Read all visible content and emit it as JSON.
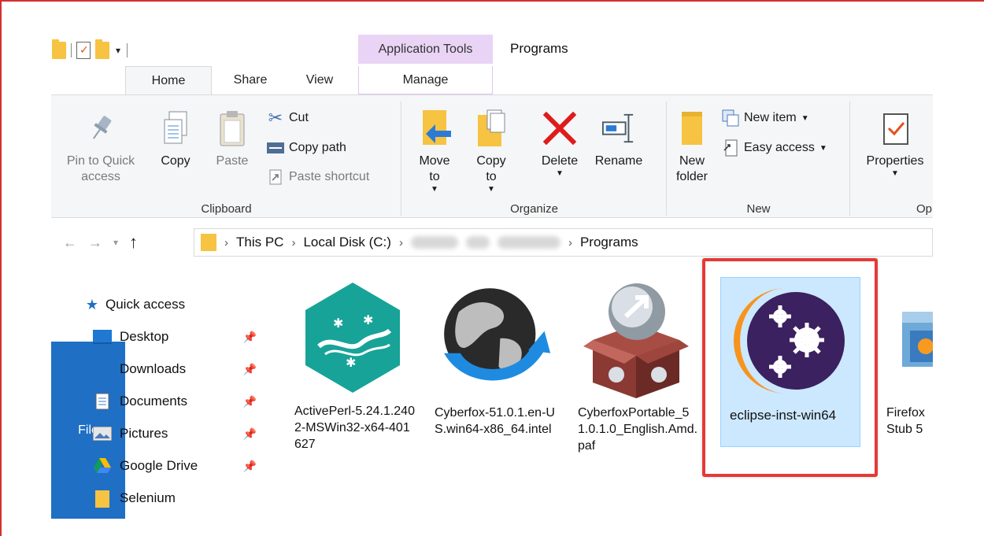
{
  "window": {
    "contextual_tab": "Application Tools",
    "title": "Programs"
  },
  "tabs": [
    "File",
    "Home",
    "Share",
    "View",
    "Manage"
  ],
  "ribbon": {
    "clipboard": {
      "group_label": "Clipboard",
      "pin": "Pin to Quick access",
      "copy": "Copy",
      "paste": "Paste",
      "cut": "Cut",
      "copy_path": "Copy path",
      "paste_shortcut": "Paste shortcut"
    },
    "organize": {
      "group_label": "Organize",
      "move_to": "Move to",
      "copy_to": "Copy to",
      "delete": "Delete",
      "rename": "Rename"
    },
    "new": {
      "group_label": "New",
      "new_folder": "New folder",
      "new_item": "New item",
      "easy_access": "Easy access"
    },
    "open": {
      "group_label": "Op",
      "properties": "Properties"
    }
  },
  "address": {
    "segments": [
      "This PC",
      "Local Disk (C:)",
      "Programs"
    ]
  },
  "nav_pane": {
    "items": [
      {
        "label": "Quick access",
        "icon": "star-icon",
        "pinned": false
      },
      {
        "label": "Desktop",
        "icon": "desktop-icon",
        "pinned": true
      },
      {
        "label": "Downloads",
        "icon": "download-arrow-icon",
        "pinned": true
      },
      {
        "label": "Documents",
        "icon": "document-icon",
        "pinned": true
      },
      {
        "label": "Pictures",
        "icon": "pictures-icon",
        "pinned": true
      },
      {
        "label": "Google Drive",
        "icon": "google-drive-icon",
        "pinned": true
      },
      {
        "label": "Selenium",
        "icon": "folder-icon",
        "pinned": false
      }
    ]
  },
  "files": [
    {
      "name": "ActivePerl-5.24.1.2402-MSWin32-x64-401627",
      "icon": "activeperl-icon"
    },
    {
      "name": "Cyberfox-51.0.1.en-US.win64-x86_64.intel",
      "icon": "cyberfox-globe-icon"
    },
    {
      "name": "CyberfoxPortable_51.0.1.0_English.Amd.paf",
      "icon": "cyberfox-portable-box-icon"
    },
    {
      "name": "eclipse-inst-win64",
      "icon": "eclipse-installer-icon",
      "selected": true
    },
    {
      "name": "Firefox Stub 5",
      "icon": "firefox-installer-icon"
    }
  ],
  "colors": {
    "file_tab": "#1f6fc5",
    "contextual_tab": "#e9d4f5",
    "selection": "#cce8ff",
    "highlight_box": "#e53935",
    "eclipse_purple": "#3b2160",
    "eclipse_orange": "#f7941e"
  }
}
